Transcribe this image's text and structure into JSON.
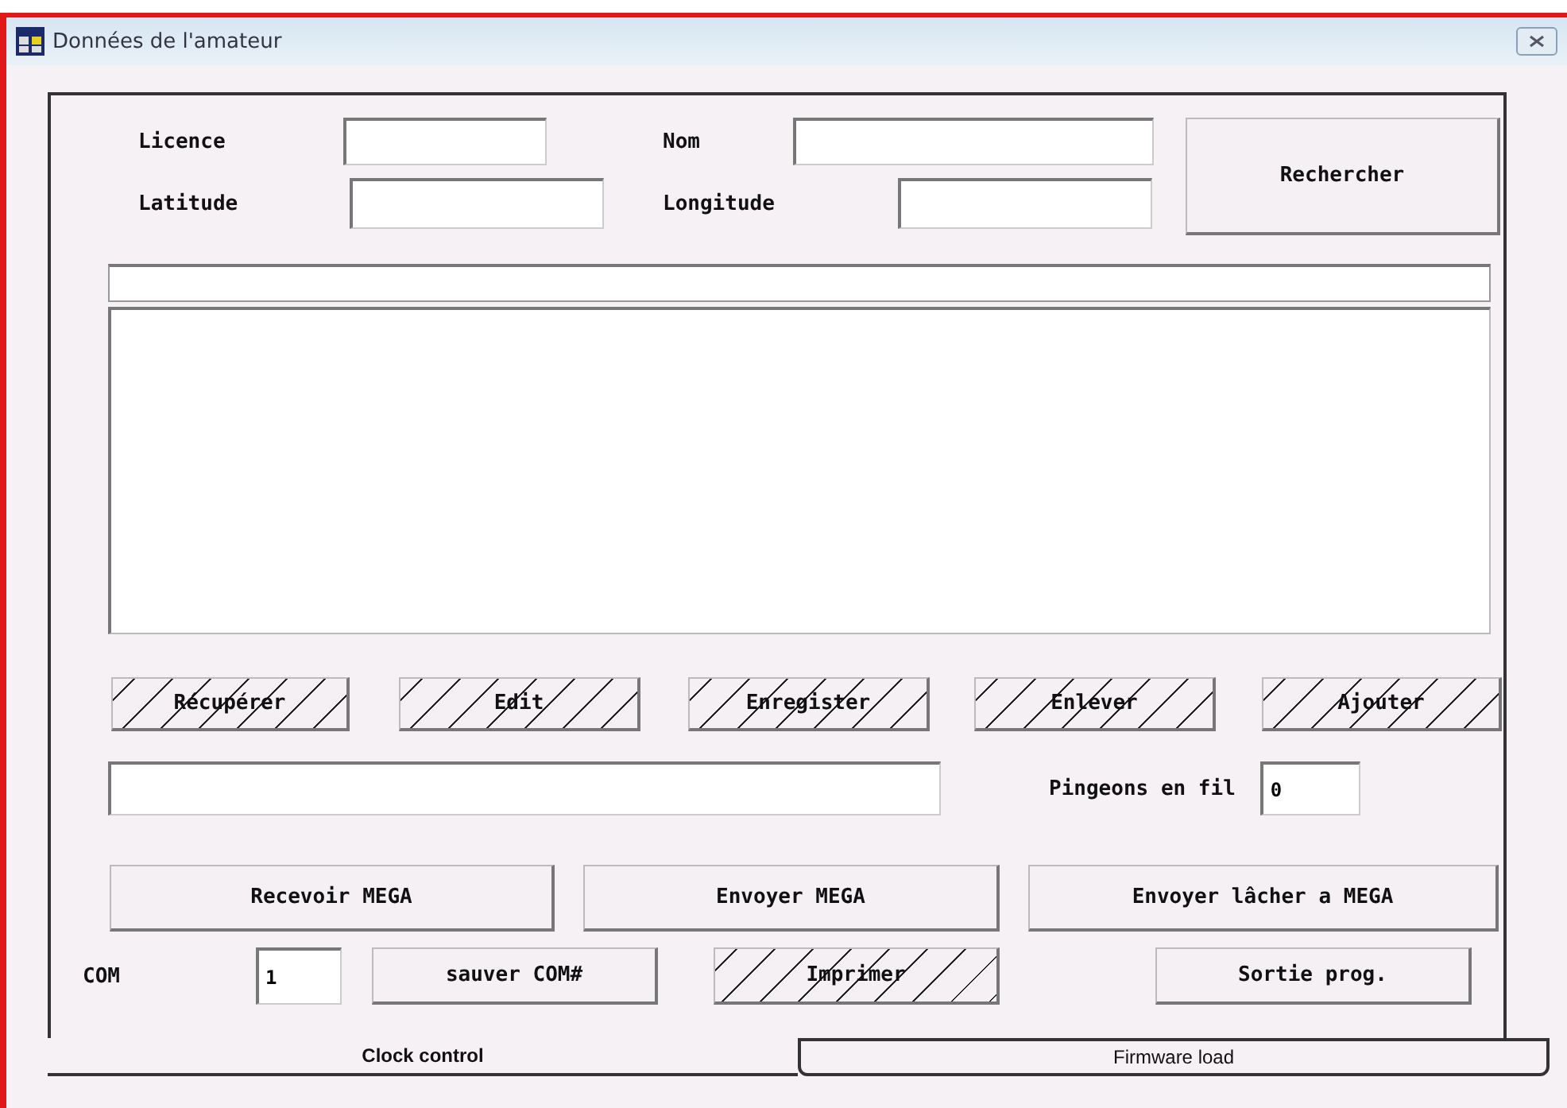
{
  "window": {
    "title": "Données de l'amateur"
  },
  "fields": [
    {
      "label": "Licence"
    },
    {
      "label": "Nom"
    },
    {
      "label": "Latitude"
    },
    {
      "label": "Longitude"
    }
  ],
  "search_button": {
    "label": "Rechercher"
  },
  "action_buttons": [
    {
      "label": "Récupérer",
      "disabled": true
    },
    {
      "label": "Edit",
      "disabled": true
    },
    {
      "label": "Enregister",
      "disabled": true
    },
    {
      "label": "Enlever",
      "disabled": true
    },
    {
      "label": "Ajouter",
      "disabled": true
    }
  ],
  "pigeons": {
    "label": "Pingeons en fil",
    "value": "0"
  },
  "mega_buttons": [
    {
      "label": "Recevoir MEGA",
      "disabled": false
    },
    {
      "label": "Envoyer MEGA",
      "disabled": false
    },
    {
      "label": "Envoyer lâcher a MEGA",
      "disabled": false
    }
  ],
  "com": {
    "label": "COM",
    "value": "1"
  },
  "bottom_buttons": [
    {
      "label": "sauver COM#",
      "disabled": false
    },
    {
      "label": "Imprimer",
      "disabled": true
    },
    {
      "label": "Sortie prog.",
      "disabled": false
    }
  ],
  "tabs": [
    {
      "label": "Clock control",
      "selected": true
    },
    {
      "label": "Firmware load",
      "selected": false
    }
  ]
}
